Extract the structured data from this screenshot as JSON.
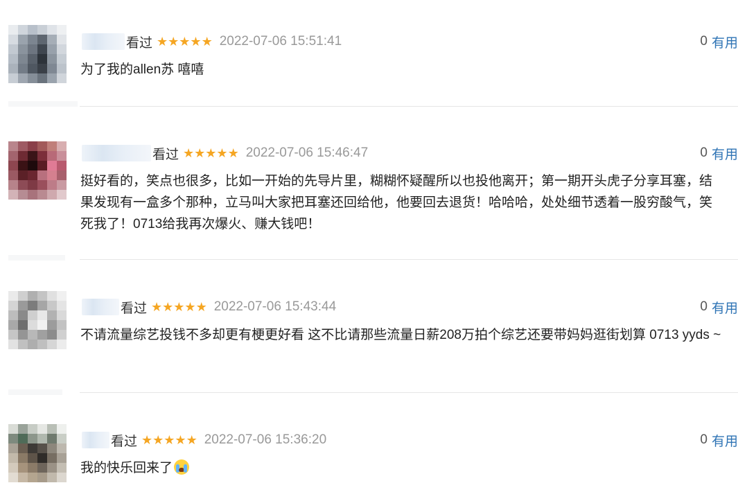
{
  "comments": [
    {
      "status": "看过",
      "rating": "★★★★★",
      "time": "2022-07-06 15:51:41",
      "votes": "0",
      "useful_label": "有用",
      "text": "为了我的allen苏 嘻嘻"
    },
    {
      "status": "看过",
      "rating": "★★★★★",
      "time": "2022-07-06 15:46:47",
      "votes": "0",
      "useful_label": "有用",
      "text": "挺好看的，笑点也很多，比如一开始的先导片里，糊糊怀疑醒所以也投他离开；第一期开头虎子分享耳塞，结果发现有一盒多个那种，立马叫大家把耳塞还回给他，他要回去退货！哈哈哈，处处细节透着一股穷酸气，笑死我了！0713给我再次爆火、赚大钱吧！"
    },
    {
      "status": "看过",
      "rating": "★★★★★",
      "time": "2022-07-06 15:43:44",
      "votes": "0",
      "useful_label": "有用",
      "text": "不请流量综艺投钱不多却更有梗更好看 这不比请那些流量日薪208万拍个综艺还要带妈妈逛街划算 0713 yyds ~"
    },
    {
      "status": "看过",
      "rating": "★★★★★",
      "time": "2022-07-06 15:36:20",
      "votes": "0",
      "useful_label": "有用",
      "text": "我的快乐回来了",
      "emoji": "crying-emoji"
    }
  ],
  "colors": {
    "star": "#f5a623",
    "useful_link": "#2f74b5",
    "timestamp": "#999999"
  }
}
